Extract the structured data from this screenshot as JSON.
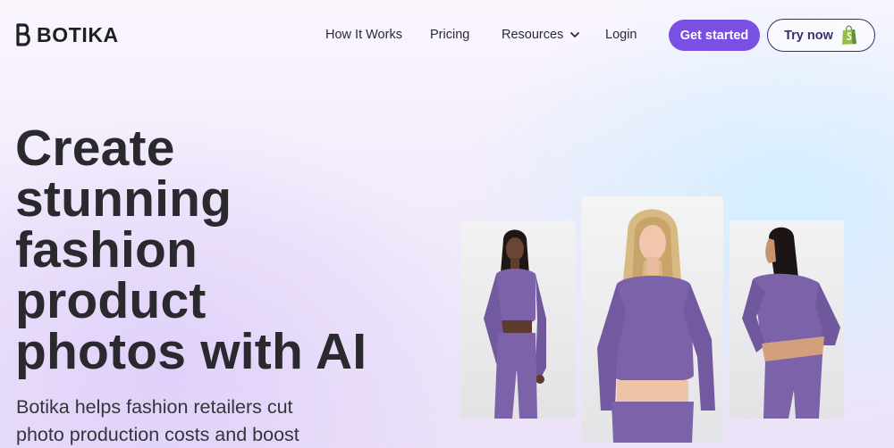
{
  "brand": {
    "name": "BOTIKA",
    "icon": "botika-logo-icon"
  },
  "nav": {
    "how_it_works": "How It Works",
    "pricing": "Pricing",
    "resources": "Resources",
    "resources_icon": "chevron-down-icon",
    "login": "Login"
  },
  "buttons": {
    "get_started": "Get started",
    "try_now": "Try now",
    "try_now_icon": "shopify-bag-icon"
  },
  "hero": {
    "title_lines": [
      "Create",
      "stunning",
      "fashion",
      "product",
      "photos with AI"
    ],
    "subtitle": "Botika helps fashion retailers cut photo production costs and boost"
  },
  "photos": [
    {
      "name": "model-photo-left",
      "subject": "woman in purple crop top front view"
    },
    {
      "name": "model-photo-center",
      "subject": "blonde woman in purple crop top front view"
    },
    {
      "name": "model-photo-right",
      "subject": "woman in purple crop top back view"
    }
  ],
  "colors": {
    "accent": "#7a4fe3",
    "outfit": "#7c62a8",
    "outline_button": "#3b2f6b",
    "shopify_green": "#95bf47"
  }
}
